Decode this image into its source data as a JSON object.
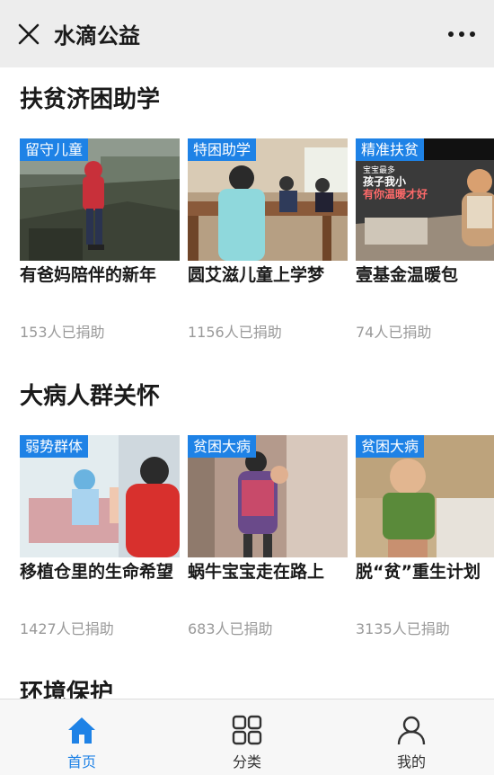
{
  "header": {
    "title": "水滴公益"
  },
  "sections": [
    {
      "title": "扶贫济困助学",
      "cards": [
        {
          "tag": "留守儿童",
          "title": "有爸妈陪伴的新年",
          "donors": "153人已捐助"
        },
        {
          "tag": "特困助学",
          "title": "圆艾滋儿童上学梦",
          "donors": "1156人已捐助"
        },
        {
          "tag": "精准扶贫",
          "title": "壹基金温暖包",
          "donors": "74人已捐助",
          "image_text": {
            "line1": "宝宝最多",
            "line2": "孩子我小",
            "line3": "有你温暖才好"
          }
        }
      ]
    },
    {
      "title": "大病人群关怀",
      "cards": [
        {
          "tag": "弱势群体",
          "title": "移植仓里的生命希望",
          "donors": "1427人已捐助"
        },
        {
          "tag": "贫困大病",
          "title": "蜗牛宝宝走在路上",
          "donors": "683人已捐助"
        },
        {
          "tag": "贫困大病",
          "title": "脱“贫”重生计划",
          "donors": "3135人已捐助"
        }
      ]
    },
    {
      "title": "环境保护"
    }
  ],
  "bottom_nav": [
    {
      "label": "首页",
      "icon": "home-icon",
      "active": true
    },
    {
      "label": "分类",
      "icon": "grid-icon",
      "active": false
    },
    {
      "label": "我的",
      "icon": "user-icon",
      "active": false
    }
  ],
  "colors": {
    "accent": "#1e82e6",
    "topbar": "#ededed",
    "muted_text": "#999999"
  }
}
